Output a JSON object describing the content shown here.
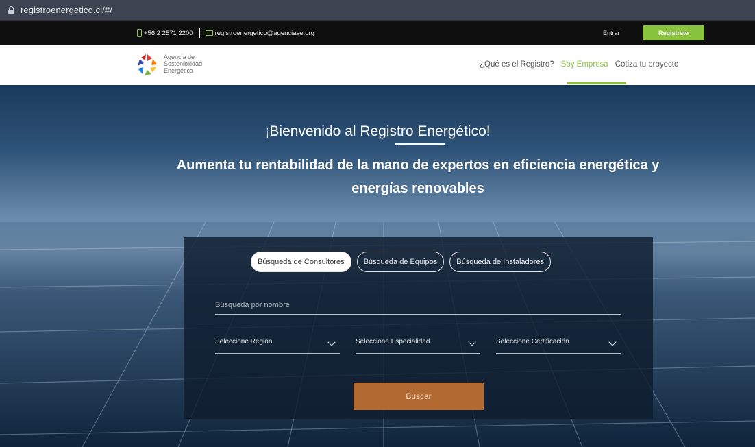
{
  "browser": {
    "url": "registroenergetico.cl/#/"
  },
  "topbar": {
    "phone": "+56 2 2571 2200",
    "email": "registroenergetico@agenciase.org",
    "login_label": "Entrar",
    "register_label": "Registrate"
  },
  "navbar": {
    "logo_lines": [
      "Agencia de",
      "Sostenibilidad",
      "Energética"
    ],
    "links": [
      {
        "label": "¿Qué es el Registro?"
      },
      {
        "label": "Soy Empresa"
      },
      {
        "label": "Cotiza tu proyecto"
      }
    ],
    "active_link": "Soy Empresa"
  },
  "hero": {
    "title": "¡Bienvenido al Registro Energético!",
    "subtitle": "Aumenta tu rentabilidad de la mano de expertos en eficiencia energética y energías renovables"
  },
  "search": {
    "tabs": [
      {
        "label": "Búsqueda de Consultores",
        "active": true
      },
      {
        "label": "Búsqueda de Equipos",
        "active": false
      },
      {
        "label": "Búsqueda de Instaladores",
        "active": false
      }
    ],
    "name_placeholder": "Búsqueda por nombre",
    "selects": [
      {
        "label": "Seleccione Región"
      },
      {
        "label": "Seleccione Especialidad"
      },
      {
        "label": "Seleccione Certificación"
      }
    ],
    "button_label": "Buscar"
  },
  "colors": {
    "accent_green": "#8ac43f",
    "button_orange": "#b26a32",
    "topbar_bg": "#0f0f0f"
  },
  "icons": [
    "lock-icon",
    "phone-icon",
    "mail-icon",
    "agency-logo-icon",
    "chevron-down-icon"
  ]
}
